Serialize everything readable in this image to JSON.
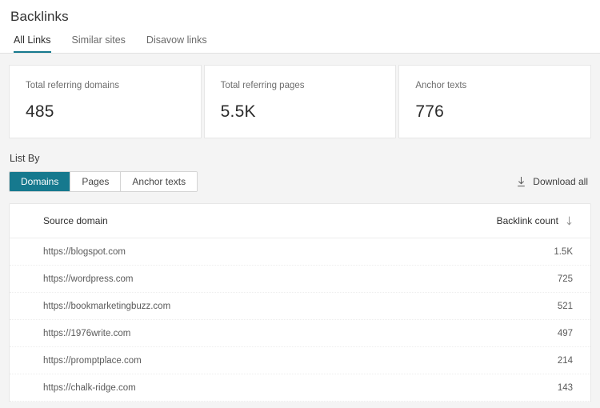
{
  "theme": {
    "accent": "#16798e",
    "page_background": "#f4f4f4",
    "card_background": "#ffffff"
  },
  "header": {
    "title": "Backlinks",
    "tabs": [
      {
        "label": "All Links",
        "active": true
      },
      {
        "label": "Similar sites",
        "active": false
      },
      {
        "label": "Disavow links",
        "active": false
      }
    ]
  },
  "stats": [
    {
      "label": "Total referring domains",
      "value": "485"
    },
    {
      "label": "Total referring pages",
      "value": "5.5K"
    },
    {
      "label": "Anchor texts",
      "value": "776"
    }
  ],
  "list_by": {
    "label": "List By",
    "options": [
      {
        "label": "Domains",
        "active": true
      },
      {
        "label": "Pages",
        "active": false
      },
      {
        "label": "Anchor texts",
        "active": false
      }
    ],
    "download": {
      "label": "Download all",
      "icon": "download-icon"
    }
  },
  "table": {
    "columns": {
      "domain": "Source domain",
      "count": "Backlink count",
      "sort_icon": "sort-descending-arrow-icon"
    },
    "rows": [
      {
        "domain": "https://blogspot.com",
        "count": "1.5K"
      },
      {
        "domain": "https://wordpress.com",
        "count": "725"
      },
      {
        "domain": "https://bookmarketingbuzz.com",
        "count": "521"
      },
      {
        "domain": "https://1976write.com",
        "count": "497"
      },
      {
        "domain": "https://promptplace.com",
        "count": "214"
      },
      {
        "domain": "https://chalk-ridge.com",
        "count": "143"
      }
    ]
  }
}
